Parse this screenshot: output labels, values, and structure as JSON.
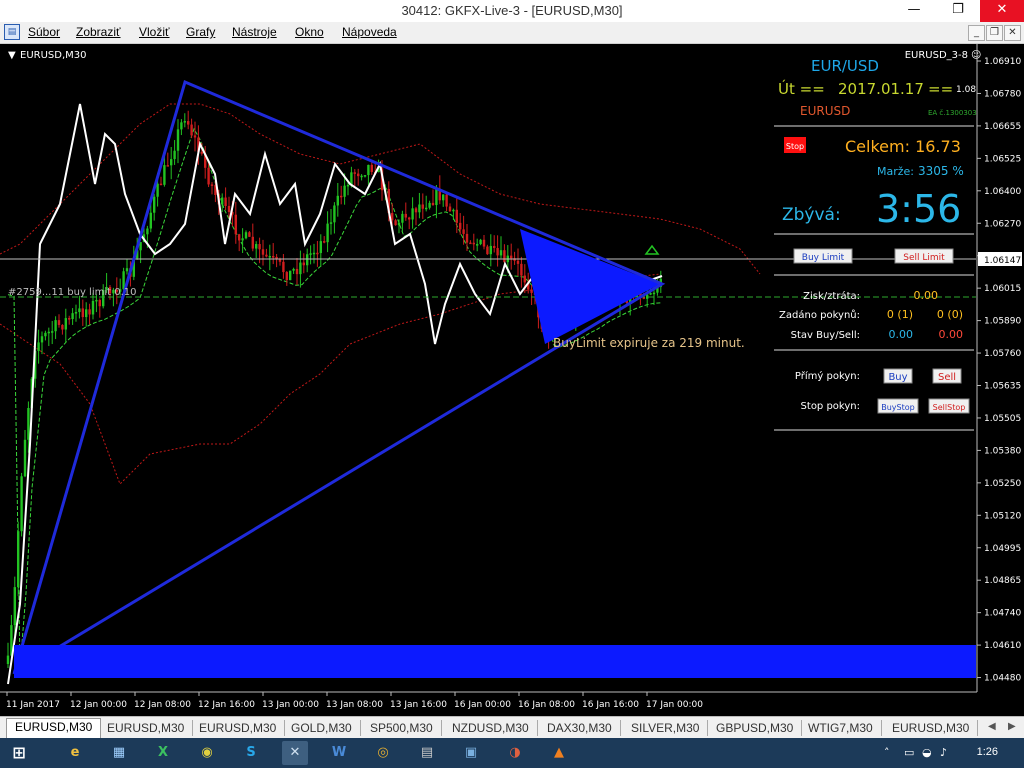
{
  "window": {
    "title": "30412: GKFX-Live-3 - [EURUSD,M30]",
    "minimize": "—",
    "restore": "❐",
    "close": "✕"
  },
  "menu": {
    "items": [
      "Súbor",
      "Zobraziť",
      "Vložiť",
      "Grafy",
      "Nástroje",
      "Okno",
      "Nápoveda"
    ],
    "mdi_minimize": "_",
    "mdi_restore": "❐",
    "mdi_close": "✕"
  },
  "chart": {
    "symbol_label": "EURUSD,M30",
    "ea_label": "EURUSD_3-8",
    "pair": "EUR/USD",
    "day_prefix": "Út  ==",
    "date": "2017.01.17",
    "day_suffix": "==",
    "small_num": "1.08",
    "symbol": "EURUSD",
    "ea_number": "EA č.1300303",
    "stop_button": "Stop",
    "total_label": "Celkem: 16.73",
    "margin_label": "Marže:",
    "margin_value": "3305 %",
    "remaining_label": "Zbývá:",
    "remaining_value": "3:56",
    "buy_limit_button": "Buy Limit",
    "sell_limit_button": "Sell Limit",
    "profit_label": "Zisk/ztráta:",
    "profit_value": "0.00",
    "orders_label": "Zadáno pokynů:",
    "orders_buy": "0 (1)",
    "orders_sell": "0 (0)",
    "state_label": "Stav Buy/Sell:",
    "state_buy": "0.00",
    "state_sell": "0.00",
    "direct_label": "Přímý pokyn:",
    "buy_button": "Buy",
    "sell_button": "Sell",
    "stop_order_label": "Stop pokyn:",
    "buystop_button": "BuyStop",
    "sellstop_button": "SellStop",
    "order_line_label": "#2759...11 buy limit 0.10",
    "expiry_text": "BuyLimit expiruje za 219 minut.",
    "price_labels": [
      "1.06910",
      "1.06780",
      "1.06655",
      "1.06525",
      "1.06400",
      "1.06270",
      "1.06147",
      "1.06015",
      "1.05890",
      "1.05760",
      "1.05635",
      "1.05505",
      "1.05380",
      "1.05250",
      "1.05120",
      "1.04995",
      "1.04865",
      "1.04740",
      "1.04610",
      "1.04480"
    ],
    "time_labels": [
      "11 Jan 2017",
      "12 Jan 00:00",
      "12 Jan 08:00",
      "12 Jan 16:00",
      "13 Jan 00:00",
      "13 Jan 08:00",
      "13 Jan 16:00",
      "16 Jan 00:00",
      "16 Jan 08:00",
      "16 Jan 16:00",
      "17 Jan 00:00"
    ],
    "current_price": "1.06147",
    "colors": {
      "bull": "#22c322",
      "bear": "#d01e1e",
      "triangle": "#1f2adb",
      "fill": "#0c1aff",
      "white_line": "#ffffff",
      "envelope": "#c01818"
    }
  },
  "tabs": {
    "items": [
      "EURUSD,M30",
      "EURUSD,M30",
      "EURUSD,M30",
      "GOLD,M30",
      "SP500,M30",
      "NZDUSD,M30",
      "DAX30,M30",
      "SILVER,M30",
      "GBPUSD,M30",
      "WTIG7,M30",
      "EURUSD,M30"
    ],
    "prev": "◀",
    "next": "▶"
  },
  "taskbar": {
    "start": "⊞",
    "clock": "1:26",
    "apps": [
      "e",
      "▦",
      "X",
      "◉",
      "S",
      "✕",
      "W",
      "◎",
      "▤",
      "▣",
      "◑",
      "▲"
    ],
    "tray_up": "˄",
    "tray_items": [
      "▭",
      "◒",
      "♪"
    ]
  }
}
